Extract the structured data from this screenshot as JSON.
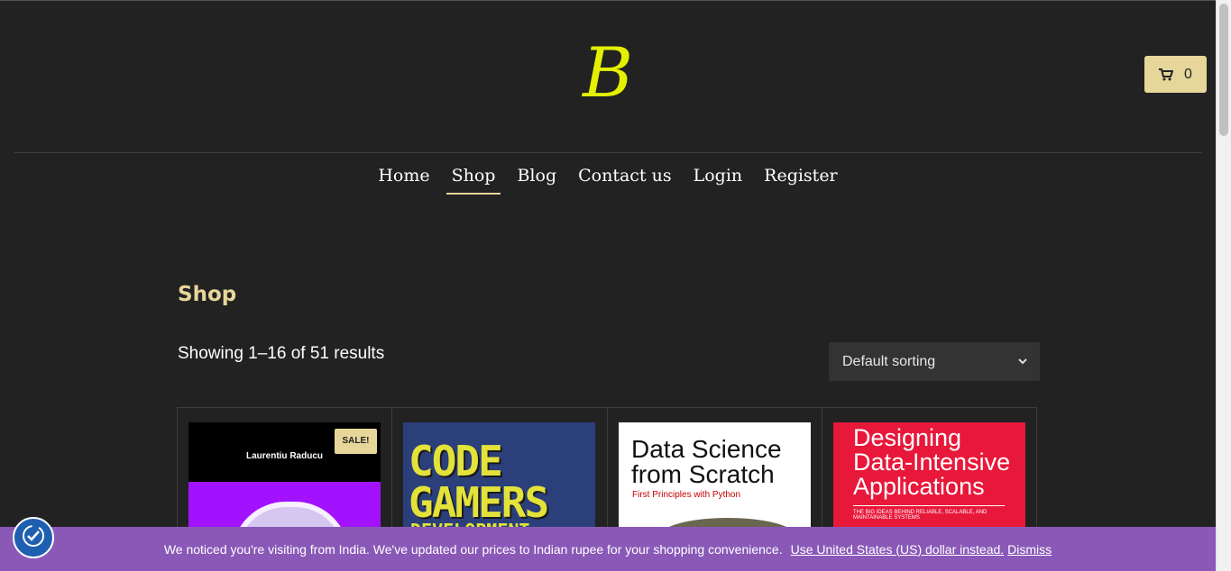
{
  "header": {
    "logo_text": "B",
    "cart_count": "0"
  },
  "nav": {
    "items": [
      {
        "label": "Home"
      },
      {
        "label": "Shop"
      },
      {
        "label": "Blog"
      },
      {
        "label": "Contact us"
      },
      {
        "label": "Login"
      },
      {
        "label": "Register"
      }
    ],
    "active": "Shop"
  },
  "main": {
    "title": "Shop",
    "result_count": "Showing 1–16 of 51 results",
    "sort": {
      "selected": "Default sorting"
    }
  },
  "products": [
    {
      "cover_author": "Laurentiu Raducu",
      "badge": "SALE!"
    },
    {
      "cover_title": "CODE GAMERS",
      "cover_subtitle": "DEVELOPMENT"
    },
    {
      "cover_title": "Data Science from Scratch",
      "cover_subtitle": "First Principles with Python"
    },
    {
      "cover_title": "Designing Data-Intensive Applications",
      "cover_subtitle": "THE BIG IDEAS BEHIND RELIABLE, SCALABLE, AND MAINTAINABLE SYSTEMS"
    }
  ],
  "notice": {
    "message": "We noticed you're visiting from India. We've updated our prices to Indian rupee for your shopping convenience.",
    "switch_link": "Use United States (US) dollar instead.",
    "dismiss_link": "Dismiss"
  },
  "colors": {
    "background": "#222222",
    "accent": "#e6d69a",
    "logo": "#e4f000",
    "notice_bg": "#8a59b7"
  },
  "icons": [
    "shopping-cart-icon",
    "chevron-down-icon",
    "privacy-settings-icon"
  ]
}
